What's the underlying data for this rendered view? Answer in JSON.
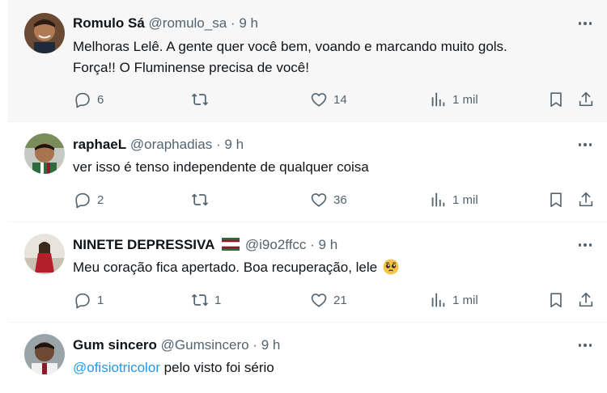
{
  "tweets": [
    {
      "name": "Romulo Sá",
      "handle": "@romulo_sa",
      "dot": "·",
      "time": "9 h",
      "text_line1": "Melhoras Lelê. A gente quer você bem, voando e marcando muito gols.",
      "text_line2": "Força!! O Fluminense precisa de você!",
      "replies": "6",
      "reposts": "",
      "likes": "14",
      "views": "1 mil"
    },
    {
      "name": "raphaeL",
      "handle": "@oraphadias",
      "dot": "·",
      "time": "9 h",
      "text_line1": "ver isso é tenso independente de qualquer coisa",
      "replies": "2",
      "reposts": "",
      "likes": "36",
      "views": "1 mil"
    },
    {
      "name": "NINETE DEPRESSIVA",
      "flag": "fluminense-flag",
      "handle": "@i9o2ffcc",
      "dot": "·",
      "time": "9 h",
      "text_line1": "Meu coração fica apertado. Boa recuperação, lele",
      "emoji": "pleading-face-emoji",
      "replies": "1",
      "reposts": "1",
      "likes": "21",
      "views": "1 mil"
    },
    {
      "name": "Gum sincero",
      "handle": "@Gumsincero",
      "dot": "·",
      "time": "9 h",
      "mention": "@ofisiotricolor",
      "text_line1": " pelo visto foi sério"
    }
  ],
  "colors": {
    "text": "#0f1419",
    "secondary": "#536471",
    "link": "#1d9bf0",
    "hover_bg": "#f7f7f7",
    "divider": "#eff3f4"
  }
}
